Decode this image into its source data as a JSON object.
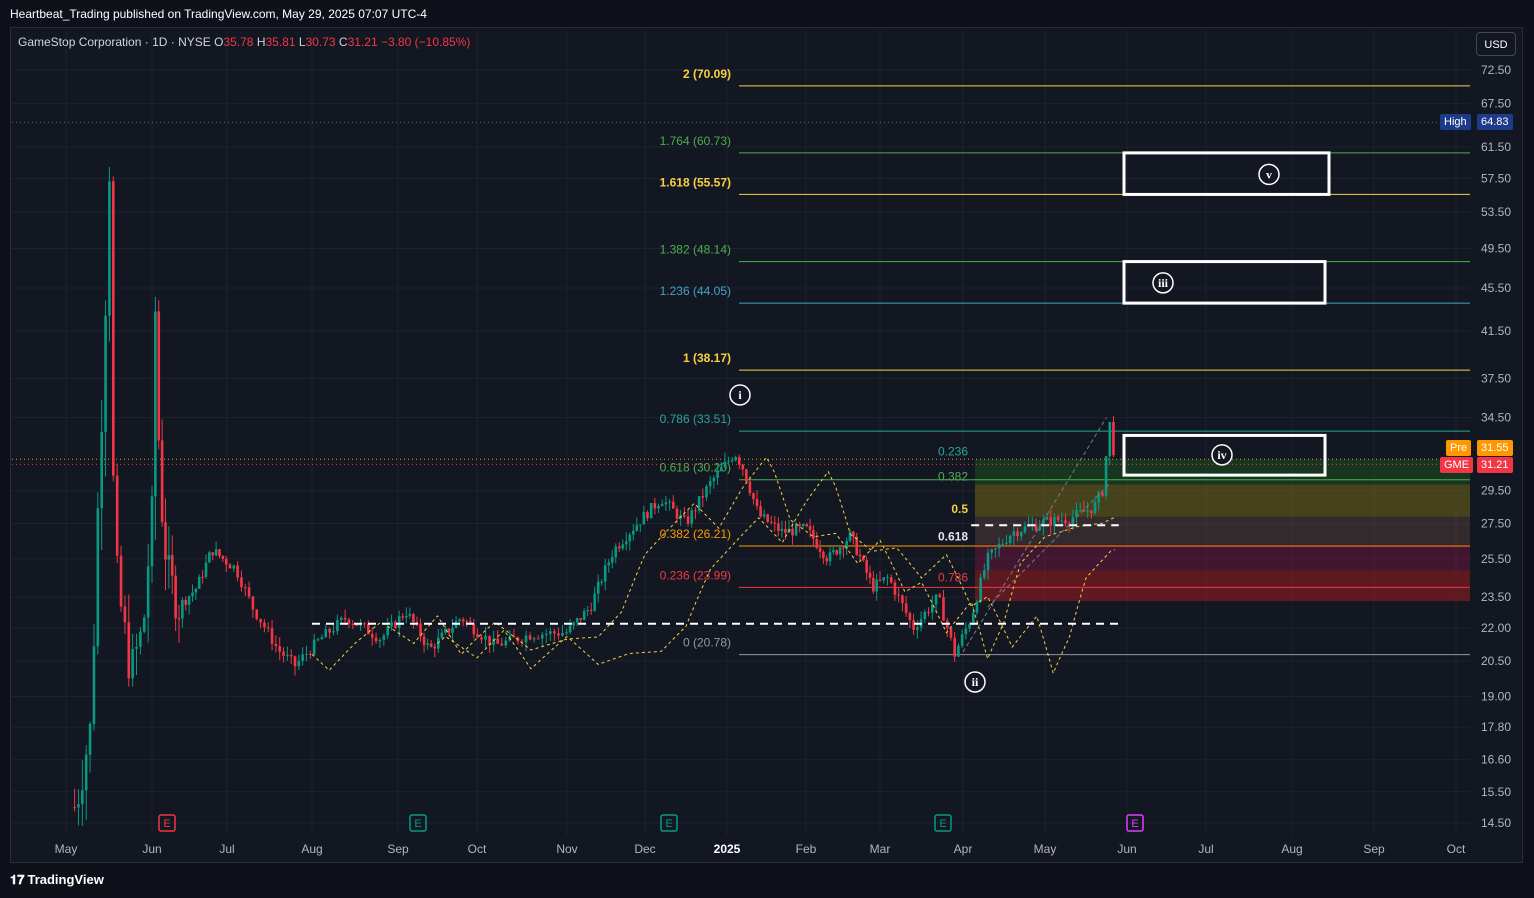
{
  "header": {
    "credit": "Heartbeat_Trading published on TradingView.com, May 29, 2025 07:07 UTC-4"
  },
  "legend": {
    "symbol": "GameStop Corporation · 1D · NYSE",
    "open_label": "O",
    "open": "35.78",
    "high_label": "H",
    "high": "35.81",
    "low_label": "L",
    "low": "30.73",
    "close_label": "C",
    "close": "31.21",
    "change": "−3.80 (−10.85%)"
  },
  "currency_button": "USD",
  "footer": {
    "logo_mark": "𝟏𝟕",
    "logo_text": "TradingView"
  },
  "price_badges": {
    "high": {
      "label": "High",
      "value": "64.83",
      "color": "#1e3a8a"
    },
    "pre": {
      "label": "Pre",
      "value": "31.55",
      "color": "#ff9800"
    },
    "last": {
      "label": "GME",
      "value": "31.21",
      "color": "#f23645"
    }
  },
  "chart_data": {
    "type": "candlestick",
    "symbol": "GME",
    "y_axis_ticks": [
      "72.50",
      "67.50",
      "61.50",
      "57.50",
      "53.50",
      "49.50",
      "45.50",
      "41.50",
      "37.50",
      "34.50",
      "29.50",
      "27.50",
      "25.50",
      "23.50",
      "22.00",
      "20.50",
      "19.00",
      "17.80",
      "16.60",
      "15.50",
      "14.50"
    ],
    "y_scale": "log",
    "x_axis_ticks": [
      "May",
      "Jun",
      "Jul",
      "Aug",
      "Sep",
      "Oct",
      "Nov",
      "Dec",
      "2025",
      "Feb",
      "Mar",
      "Apr",
      "May",
      "Jun",
      "Jul",
      "Aug",
      "Sep",
      "Oct"
    ],
    "extension_levels": [
      {
        "label": "2 (70.09)",
        "value": 70.09,
        "color": "#f5d142"
      },
      {
        "label": "1.764 (60.73)",
        "value": 60.73,
        "color": "#4caf50"
      },
      {
        "label": "1.618 (55.57)",
        "value": 55.57,
        "color": "#f5d142"
      },
      {
        "label": "1.382 (48.14)",
        "value": 48.14,
        "color": "#4caf50"
      },
      {
        "label": "1.236 (44.05)",
        "value": 44.05,
        "color": "#42a5c8"
      },
      {
        "label": "1 (38.17)",
        "value": 38.17,
        "color": "#f5d142"
      },
      {
        "label": "0.786 (33.51)",
        "value": 33.51,
        "color": "#26a69a"
      },
      {
        "label": "0.618 (30.20)",
        "value": 30.2,
        "color": "#4caf50"
      },
      {
        "label": "0.382 (26.21)",
        "value": 26.21,
        "color": "#ff9800"
      },
      {
        "label": "0.236 (23.99)",
        "value": 23.99,
        "color": "#f23645"
      },
      {
        "label": "0 (20.78)",
        "value": 20.78,
        "color": "#9598a1"
      }
    ],
    "retracement_labels": [
      {
        "label": "0.236",
        "value": 31.55,
        "color": "#26a69a"
      },
      {
        "label": "0.382",
        "value": 29.9,
        "color": "#4caf50"
      },
      {
        "label": "0.5",
        "value": 27.9,
        "color": "#f5d142"
      },
      {
        "label": "0.618",
        "value": 26.3,
        "color": "#e6e6e6"
      },
      {
        "label": "0.786",
        "value": 24.1,
        "color": "#f23645"
      }
    ],
    "wave_labels": [
      "i",
      "ii",
      "iii",
      "iv",
      "v"
    ],
    "target_boxes": [
      {
        "wave": "v",
        "low": 55.57,
        "high": 60.73
      },
      {
        "wave": "iii",
        "low": 44.05,
        "high": 48.14
      },
      {
        "wave": "iv",
        "low": 30.5,
        "high": 33.2
      }
    ],
    "earnings_markers": [
      {
        "label": "E",
        "month": "Jun",
        "color": "#f23645"
      },
      {
        "label": "E",
        "month": "Sep",
        "color": "#089981"
      },
      {
        "label": "E",
        "month": "Dec",
        "color": "#089981"
      },
      {
        "label": "E",
        "month": "Apr",
        "color": "#089981"
      },
      {
        "label": "E",
        "month": "Jun",
        "color": "#e040fb"
      }
    ],
    "last_price": 31.21,
    "pre_market": 31.55,
    "high": 64.83,
    "colors": {
      "up": "#089981",
      "down": "#f23645",
      "grid": "#1e222d"
    }
  }
}
